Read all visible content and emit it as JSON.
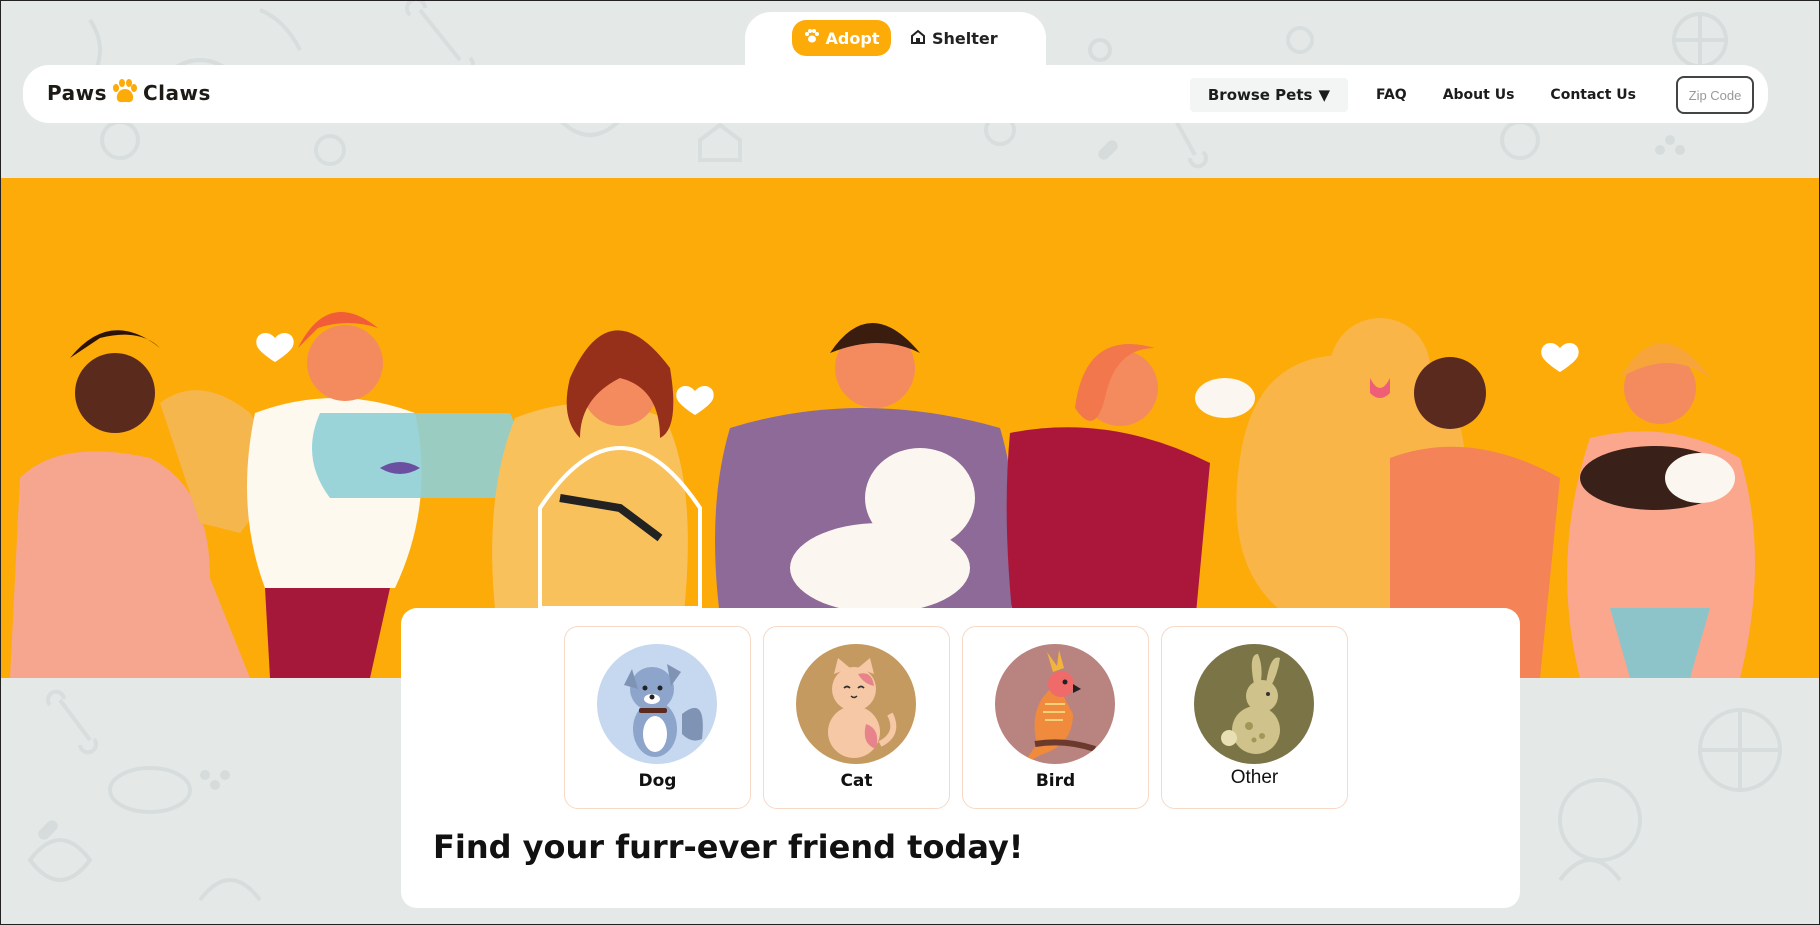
{
  "theme": {
    "accent": "#fdab09",
    "background": "#e4e9e8",
    "card": "#ffffff"
  },
  "toggle": {
    "adopt": {
      "label": "Adopt",
      "icon": "paw-icon"
    },
    "shelter": {
      "label": "Shelter",
      "icon": "house-icon"
    }
  },
  "header": {
    "logo": {
      "left": "Paws",
      "right": "Claws",
      "icon": "paw-icon"
    },
    "nav": {
      "browse": "Browse Pets",
      "browse_icon": "caret-down-icon",
      "faq": "FAQ",
      "about": "About Us",
      "contact": "Contact Us"
    },
    "zip_placeholder": "Zip Code"
  },
  "hero": {
    "illustration": "people-with-pets-illustration"
  },
  "categories": [
    {
      "label": "Dog",
      "icon": "dog-icon",
      "color": "#c5d8ef"
    },
    {
      "label": "Cat",
      "icon": "cat-icon",
      "color": "#c59a60"
    },
    {
      "label": "Bird",
      "icon": "bird-icon",
      "color": "#b98380"
    },
    {
      "label": "Other",
      "icon": "rabbit-icon",
      "color": "#7b7447"
    }
  ],
  "tagline": "Find your furr-ever friend today!"
}
